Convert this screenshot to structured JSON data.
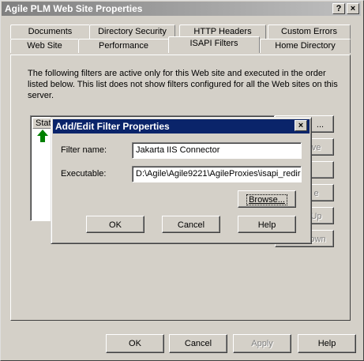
{
  "window": {
    "title": "Agile PLM Web Site Properties",
    "help_glyph": "?",
    "close_glyph": "×"
  },
  "tabs_back": [
    "Documents",
    "Directory Security",
    "HTTP Headers",
    "Custom Errors"
  ],
  "tabs_front": [
    "Web Site",
    "Performance",
    "ISAPI Filters",
    "Home Directory"
  ],
  "active_tab": "ISAPI Filters",
  "panel": {
    "description": "The following filters are active only for this Web site and executed in the order listed below. This list does not show filters configured for all the Web sites on this server.",
    "list_header": "Stat",
    "side_buttons": [
      "...",
      "ve",
      "",
      "e",
      "Up",
      "own"
    ]
  },
  "dialog": {
    "title": "Add/Edit Filter Properties",
    "filter_name_label": "Filter name:",
    "filter_name_value": "Jakarta IIS Connector",
    "executable_label": "Executable:",
    "executable_value": "D:\\Agile\\Agile9221\\AgileProxies\\isapi_redir",
    "browse": "Browse...",
    "ok": "OK",
    "cancel": "Cancel",
    "help": "Help"
  },
  "footer": {
    "ok": "OK",
    "cancel": "Cancel",
    "apply": "Apply",
    "help": "Help"
  },
  "colors": {
    "face": "#d4d0c8",
    "active_title": "#0a246a",
    "status_arrow": "#008000"
  }
}
